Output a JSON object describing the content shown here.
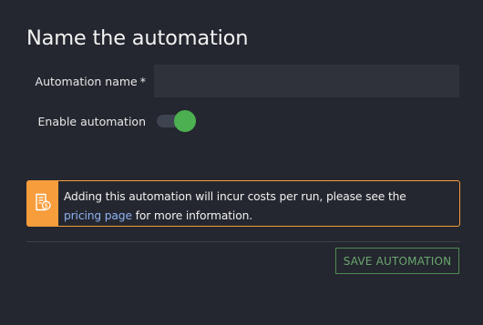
{
  "dialog": {
    "title": "Name the automation"
  },
  "form": {
    "name_label": "Automation name",
    "name_required_marker": "*",
    "name_value": "",
    "name_placeholder": "",
    "enable_label": "Enable automation",
    "enable_state": "on"
  },
  "alert": {
    "icon": "receipt-dollar-icon",
    "text_before_link": "Adding this automation will incur costs per run, please see the",
    "link_text": "pricing page",
    "text_after_link": "for more information."
  },
  "actions": {
    "save_label": "SAVE AUTOMATION"
  },
  "colors": {
    "background": "#24272f",
    "input_background": "#2f323b",
    "toggle_on": "#4caf50",
    "warning": "#f79d3c",
    "link": "#8fb2f2",
    "save_button": "#6aa66e"
  }
}
